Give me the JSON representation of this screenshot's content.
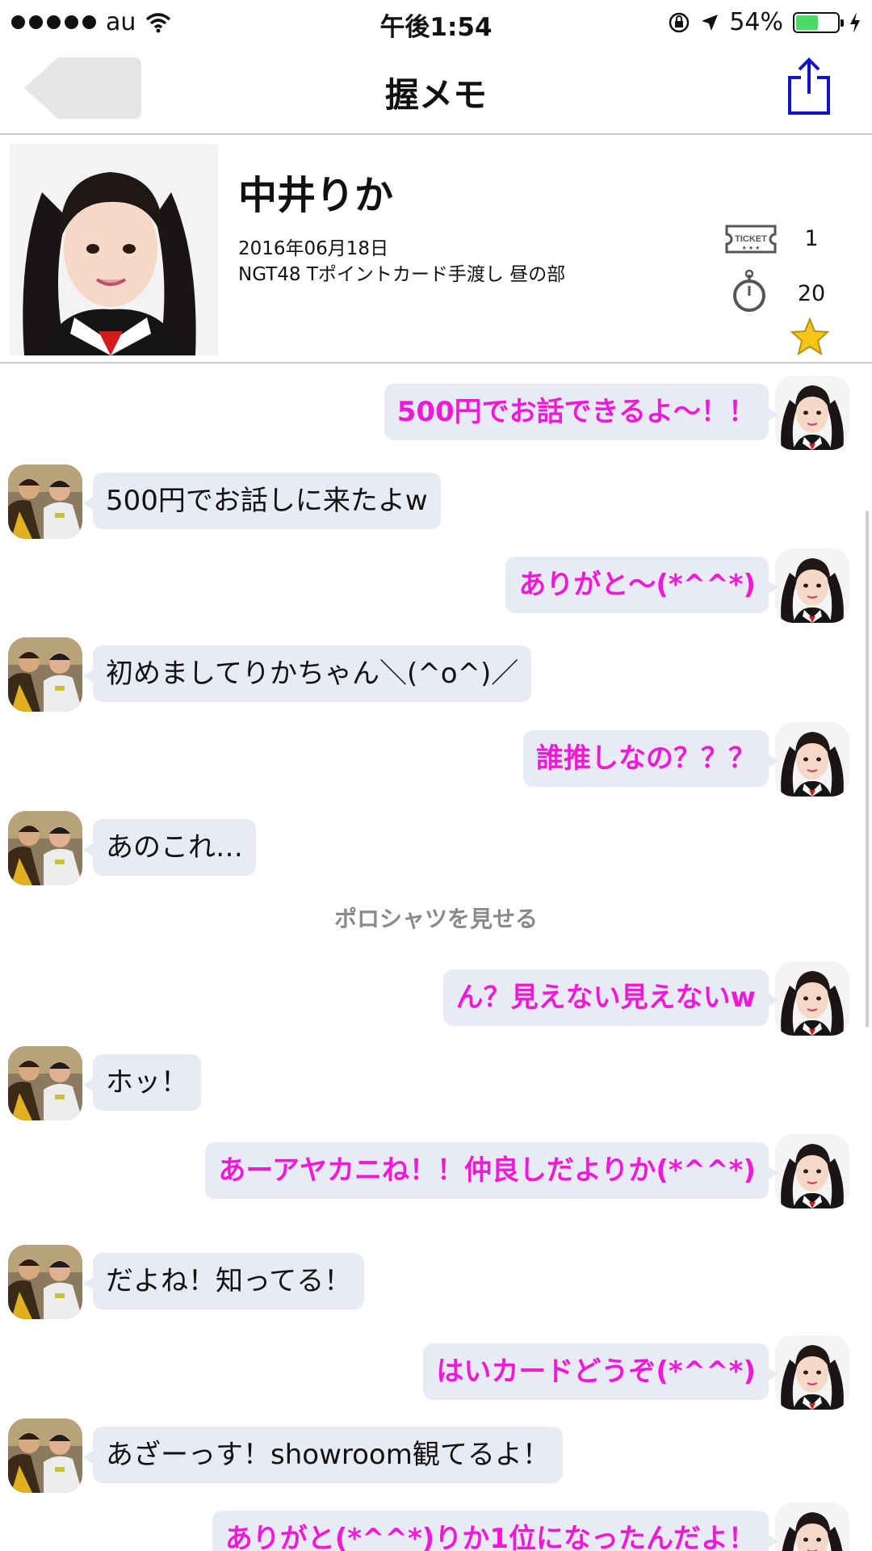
{
  "status_bar": {
    "carrier": "au",
    "time": "午後1:54",
    "battery": "54%",
    "battery_level": 0.54
  },
  "nav": {
    "title": "握メモ"
  },
  "profile": {
    "name": "中井りか",
    "date": "2016年06月18日",
    "event": "NGT48 Tポイントカード手渡し 昼の部",
    "ticket_label": "TICKET",
    "ticket_count": "1",
    "seconds": "20",
    "favorite": true
  },
  "messages": [
    {
      "side": "out",
      "text": "500円でお話できるよ〜！！"
    },
    {
      "side": "in",
      "text": "500円でお話しに来たよw"
    },
    {
      "side": "out",
      "text": "ありがと〜(*^^*)"
    },
    {
      "side": "in",
      "text": "初めましてりかちゃん＼(^o^)／"
    },
    {
      "side": "out",
      "text": "誰推しなの？？？"
    },
    {
      "side": "in",
      "text": "あのこれ…"
    },
    {
      "side": "note",
      "text": "ポロシャツを見せる"
    },
    {
      "side": "out",
      "text": "ん？見えない見えないw"
    },
    {
      "side": "in",
      "text": "ホッ！"
    },
    {
      "side": "out",
      "text": "あーアヤカニね！！仲良しだよりか(*^^*)"
    },
    {
      "side": "in",
      "text": "だよね！知ってる！"
    },
    {
      "side": "out",
      "text": "はいカードどうぞ(*^^*)"
    },
    {
      "side": "in",
      "text": "あざーっす！showroom観てるよ！"
    },
    {
      "side": "out",
      "text": "ありがと(*^^*)りか1位になったんだよ！"
    }
  ],
  "colors": {
    "outgoing_text": "#f01ad6",
    "bubble_bg": "#e8ebf5",
    "share_icon": "#1212c8",
    "star": "#f5c518"
  }
}
